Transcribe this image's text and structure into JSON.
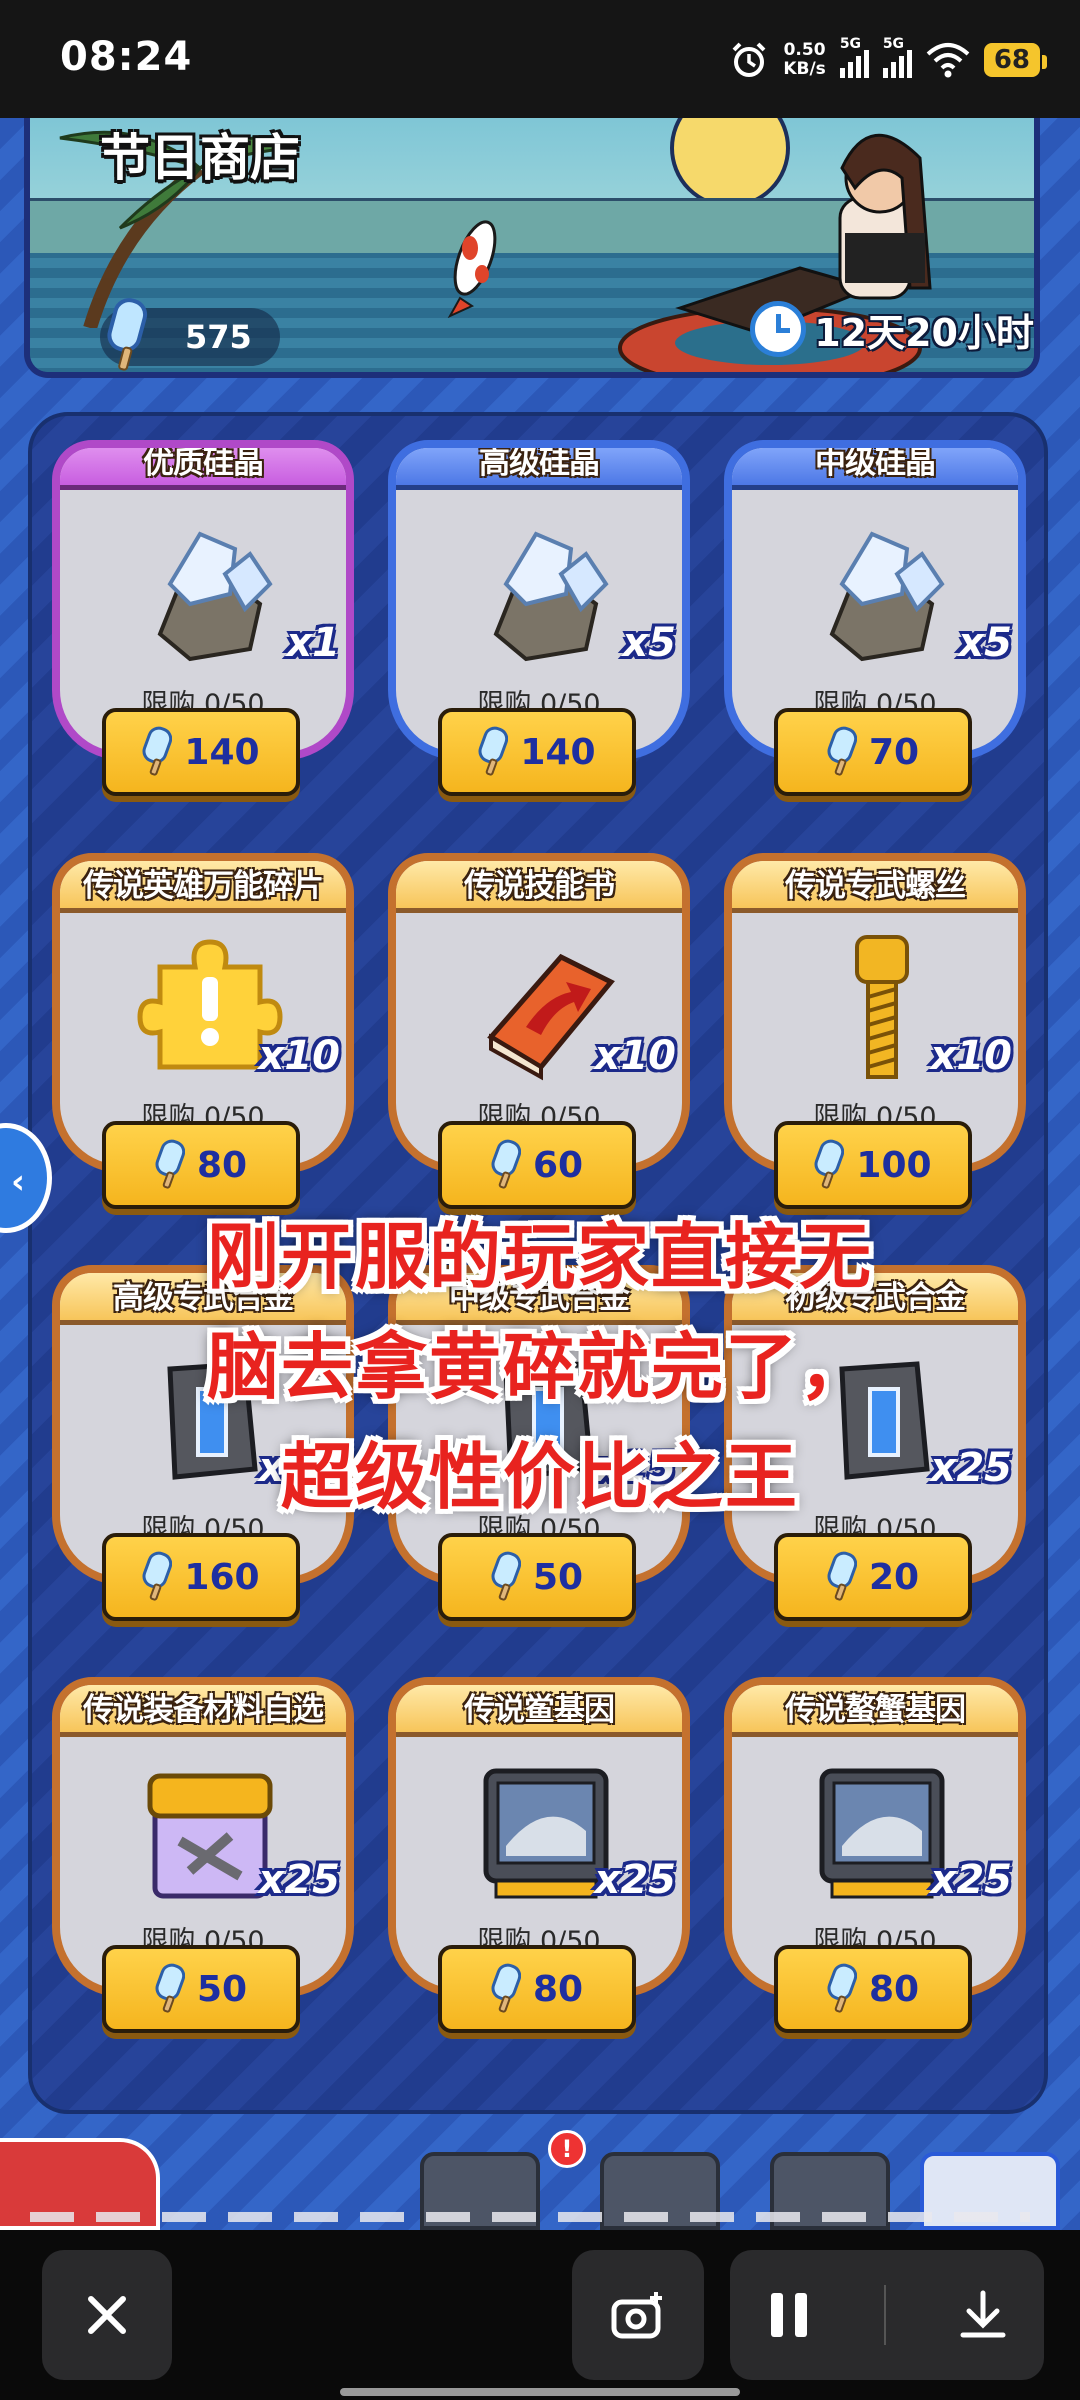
{
  "status_bar": {
    "time": "08:24",
    "net_speed_value": "0.50",
    "net_speed_unit": "KB/s",
    "signal_1_label": "5G",
    "signal_2_label": "5G",
    "battery": "68",
    "icons": [
      "alarm-icon",
      "signal-icon",
      "signal-icon",
      "wifi-icon",
      "battery-icon"
    ]
  },
  "banner": {
    "title": "节日商店",
    "currency_amount": "575",
    "currency_icon": "popsicle-icon",
    "timer_text": "12天20小时"
  },
  "shop_items": [
    {
      "name": "优质硅晶",
      "qty": "x1",
      "limit": "限购 0/50",
      "price": "140",
      "rarity": "purple",
      "icon": "crystal-ore-icon"
    },
    {
      "name": "高级硅晶",
      "qty": "x5",
      "limit": "限购 0/50",
      "price": "140",
      "rarity": "blue",
      "icon": "crystal-ore-icon"
    },
    {
      "name": "中级硅晶",
      "qty": "x5",
      "limit": "限购 0/50",
      "price": "70",
      "rarity": "blue",
      "icon": "crystal-ore-icon"
    },
    {
      "name": "传说英雄万能碎片",
      "qty": "x10",
      "limit": "限购 0/50",
      "price": "80",
      "rarity": "gold",
      "icon": "puzzle-piece-icon"
    },
    {
      "name": "传说技能书",
      "qty": "x10",
      "limit": "限购 0/50",
      "price": "60",
      "rarity": "gold",
      "icon": "skill-book-icon"
    },
    {
      "name": "传说专武螺丝",
      "qty": "x10",
      "limit": "限购 0/50",
      "price": "100",
      "rarity": "gold",
      "icon": "screw-icon"
    },
    {
      "name": "高级专武合金",
      "qty": "x35",
      "limit": "限购 0/50",
      "price": "160",
      "rarity": "gold",
      "icon": "alloy-icon"
    },
    {
      "name": "中级专武合金",
      "qty": "x25",
      "limit": "限购 0/50",
      "price": "50",
      "rarity": "gold",
      "icon": "alloy-icon"
    },
    {
      "name": "初级专武合金",
      "qty": "x25",
      "limit": "限购 0/50",
      "price": "20",
      "rarity": "gold",
      "icon": "alloy-icon"
    },
    {
      "name": "传说装备材料自选",
      "qty": "x25",
      "limit": "限购 0/50",
      "price": "50",
      "rarity": "gold",
      "icon": "material-box-icon"
    },
    {
      "name": "传说鲎基因",
      "qty": "x25",
      "limit": "限购 0/50",
      "price": "80",
      "rarity": "gold",
      "icon": "gene-monitor-icon"
    },
    {
      "name": "传说螯蟹基因",
      "qty": "x25",
      "limit": "限购 0/50",
      "price": "80",
      "rarity": "gold",
      "icon": "gene-monitor-icon"
    }
  ],
  "caption": {
    "line1": "刚开服的玩家直接无",
    "line2": "脑去拿黄碎就完了，",
    "line3": "超级性价比之王"
  },
  "game_nav": {
    "badge": "!",
    "icons": [
      "back-icon",
      "hero-icon",
      "battle-icon",
      "base-icon",
      "shop-icon"
    ]
  },
  "recorder": {
    "icons": [
      "close-icon",
      "screenshot-icon",
      "pause-icon",
      "download-icon"
    ]
  },
  "colors": {
    "accent_gold": "#f5b51e",
    "price_text": "#1e2fa0",
    "caption_red": "#e8231f",
    "panel_blue": "#213c8e"
  }
}
